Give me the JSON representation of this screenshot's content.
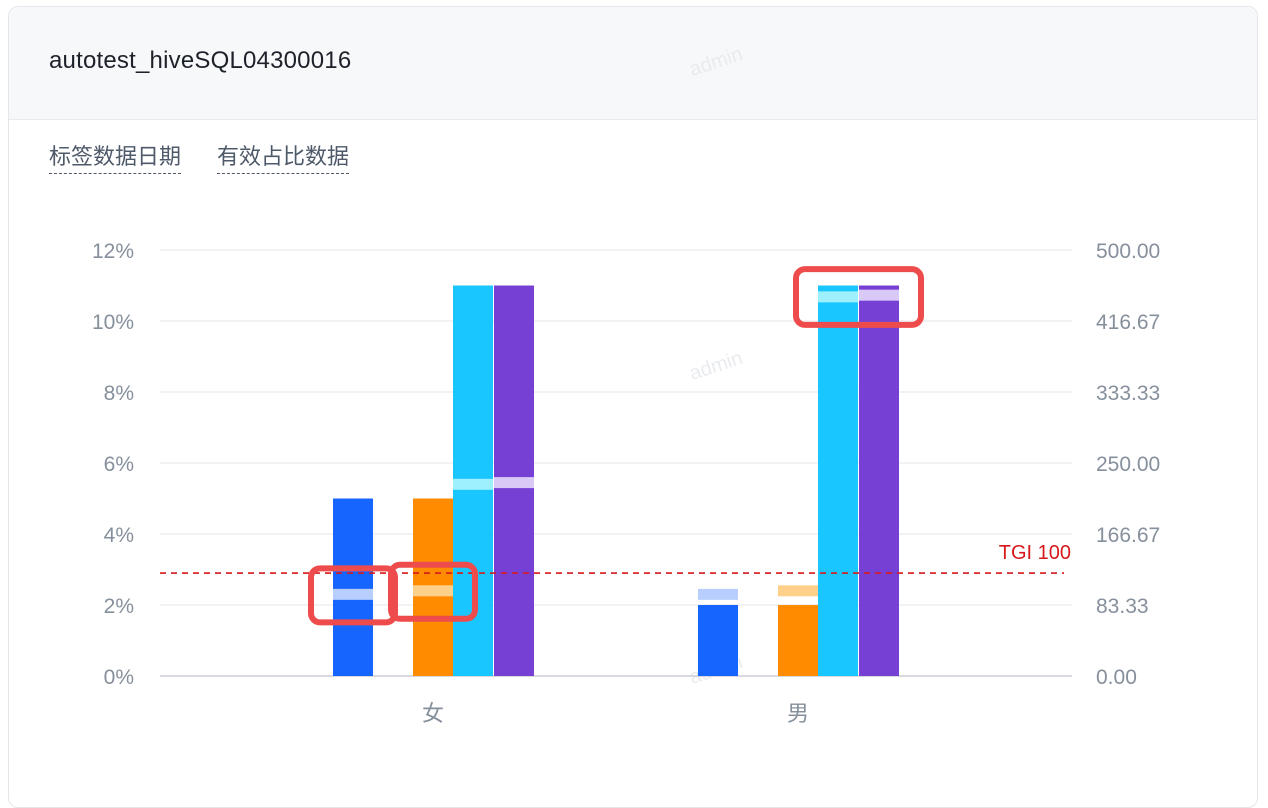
{
  "card": {
    "title": "autotest_hiveSQL04300016",
    "tabs": [
      "标签数据日期",
      "有效占比数据"
    ],
    "watermark": "admin"
  },
  "chart_data": {
    "type": "bar",
    "categories": [
      "女",
      "男"
    ],
    "left_axis": {
      "ticks": [
        "0%",
        "2%",
        "4%",
        "6%",
        "8%",
        "10%",
        "12%"
      ],
      "range": [
        0,
        12
      ],
      "unit": "%"
    },
    "right_axis": {
      "ticks": [
        "0.00",
        "83.33",
        "166.67",
        "250.00",
        "333.33",
        "416.67",
        "500.00"
      ],
      "range": [
        0,
        500
      ]
    },
    "series": [
      {
        "axis": "left",
        "color": "#1765ff",
        "highlight": "#b7ceff",
        "values": [
          5.0,
          2.0
        ],
        "highlight_values": [
          2.3,
          2.3
        ]
      },
      {
        "axis": "left",
        "color": "#ff8c00",
        "highlight": "#ffd08a",
        "values": [
          5.0,
          2.0
        ],
        "highlight_values": [
          2.4,
          2.4
        ]
      },
      {
        "axis": "right",
        "color": "#1ac6ff",
        "highlight": "#9ef0ff",
        "values": [
          458.33,
          458.33
        ],
        "highlight_values": [
          225,
          445
        ]
      },
      {
        "axis": "right",
        "color": "#7640d4",
        "highlight": "#d9c9f7",
        "values": [
          458.33,
          458.33
        ],
        "highlight_values": [
          227,
          447
        ]
      }
    ],
    "reference_line": {
      "label": "TGI 100",
      "value": 2.9,
      "axis": "left",
      "color": "#d7191c"
    },
    "annotations": [
      {
        "category": "女",
        "series": [
          0
        ]
      },
      {
        "category": "女",
        "series": [
          1
        ]
      },
      {
        "category": "男",
        "series": [
          2,
          3
        ]
      }
    ],
    "grid": true,
    "gridColor": "#e5e6eb",
    "axisTextColor": "#86909c"
  }
}
